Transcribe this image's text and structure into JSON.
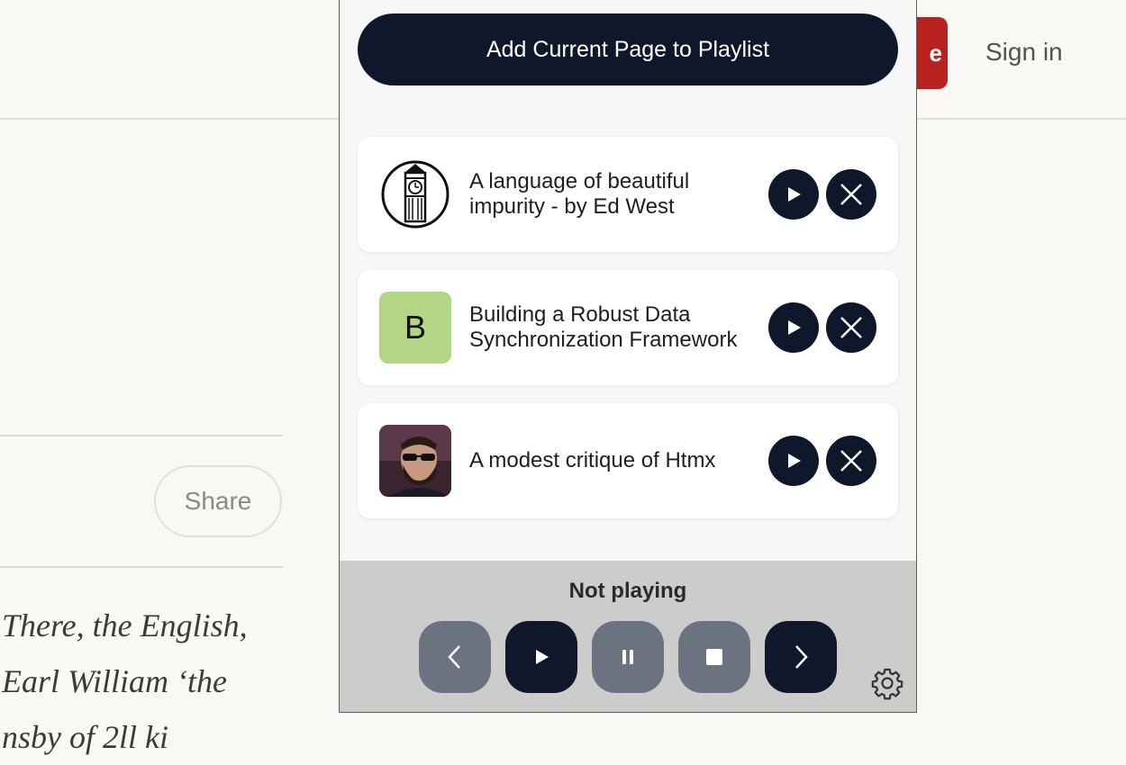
{
  "background": {
    "subscribe_partial": "e",
    "sign_in": "Sign in",
    "share": "Share",
    "article_lines": [
      "There, the English,",
      "Earl William ‘the",
      "nsby of 2ll ki"
    ]
  },
  "popup": {
    "add_button": "Add Current Page to Playlist",
    "playlist": [
      {
        "title": "A language of beautiful impurity - by Ed West",
        "thumb": "clock-tower-logo"
      },
      {
        "title": "Building a Robust Data Synchronization Framework",
        "thumb_letter": "B",
        "thumb_color": "#b3d686"
      },
      {
        "title": "A modest critique of Htmx",
        "thumb": "bearded-man-avatar"
      }
    ],
    "player": {
      "status": "Not playing",
      "controls": [
        "previous",
        "play",
        "pause",
        "stop",
        "next"
      ]
    }
  },
  "colors": {
    "primary": "#0f172a",
    "muted": "#6b7280",
    "accent_red": "#b8231f"
  }
}
